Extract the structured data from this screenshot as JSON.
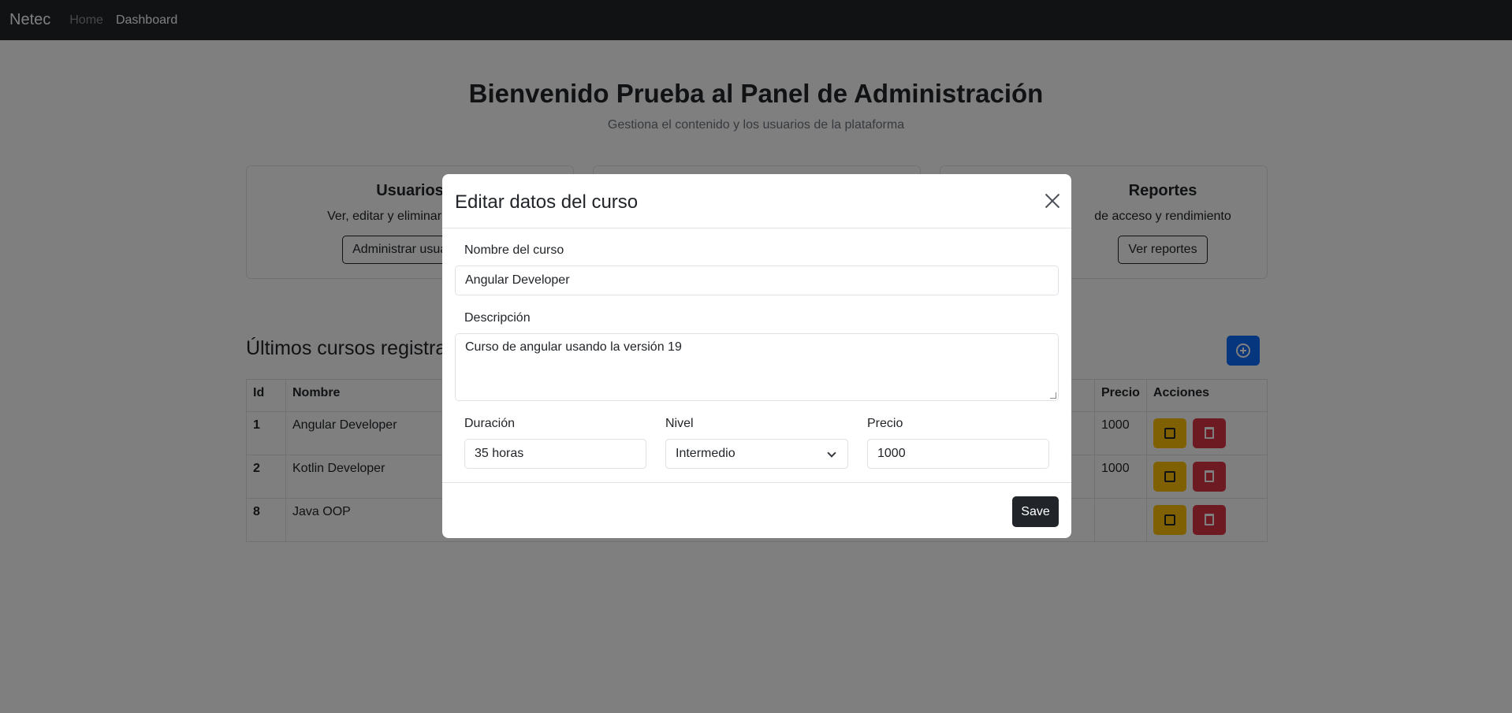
{
  "navbar": {
    "brand": "Netec",
    "links": [
      "Home",
      "Dashboard"
    ]
  },
  "hero": {
    "title": "Bienvenido Prueba al Panel de Administración",
    "subtitle": "Gestiona el contenido y los usuarios de la plataforma"
  },
  "cards": [
    {
      "title": "Usuarios",
      "text": "Ver, editar y eliminar usuarios",
      "button": "Administrar usuarios"
    },
    {
      "title": "",
      "text": "",
      "button": ""
    },
    {
      "title": "Reportes",
      "text": "de acceso y rendimiento",
      "button": "Ver reportes"
    }
  ],
  "courses": {
    "title": "Últimos cursos registrados",
    "columns": [
      "Id",
      "Nombre",
      "Precio",
      "Acciones"
    ],
    "rows": [
      {
        "id": "1",
        "name": "Angular Developer",
        "price": "1000"
      },
      {
        "id": "2",
        "name": "Kotlin Developer",
        "price": "1000"
      },
      {
        "id": "8",
        "name": "Java OOP",
        "price": ""
      }
    ]
  },
  "modal": {
    "title": "Editar datos del curso",
    "name_label": "Nombre del curso",
    "name_value": "Angular Developer",
    "desc_label": "Descripción",
    "desc_value": "Curso de angular usando la versión 19",
    "duration_label": "Duración",
    "duration_value": "35 horas",
    "level_label": "Nivel",
    "level_value": "Intermedio",
    "price_label": "Precio",
    "price_value": "1000",
    "save_label": "Save"
  },
  "colors": {
    "navbar": "#212529",
    "primary": "#0d6efd",
    "warning": "#ffc107",
    "danger": "#dc3545"
  }
}
